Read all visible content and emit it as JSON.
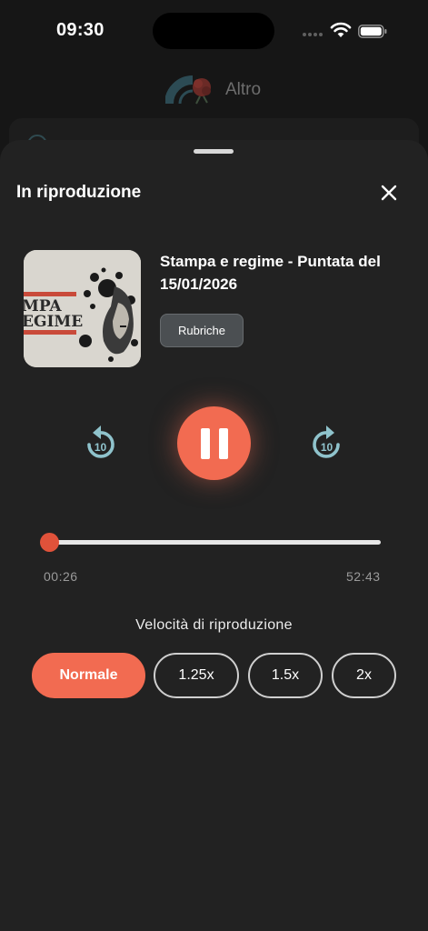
{
  "status_bar": {
    "time": "09:30"
  },
  "background_app": {
    "title": "Altro"
  },
  "sheet": {
    "title": "In riproduzione",
    "close_icon": "close-icon"
  },
  "track": {
    "title": "Stampa e regime - Puntata del 15/01/2026",
    "category": "Rubriche",
    "artwork_text_line1": "MPA",
    "artwork_text_line2": "EGIME"
  },
  "player": {
    "state": "playing",
    "skip_back_seconds": "10",
    "skip_forward_seconds": "10",
    "elapsed": "00:26",
    "duration": "52:43",
    "progress_fraction": 0.008
  },
  "speed": {
    "label": "Velocità di riproduzione",
    "options": [
      "Normale",
      "1.25x",
      "1.5x",
      "2x"
    ],
    "selected": "Normale"
  },
  "colors": {
    "accent": "#f26b51",
    "sheet_bg": "#222222",
    "skip_icon": "#8fc3cc"
  }
}
